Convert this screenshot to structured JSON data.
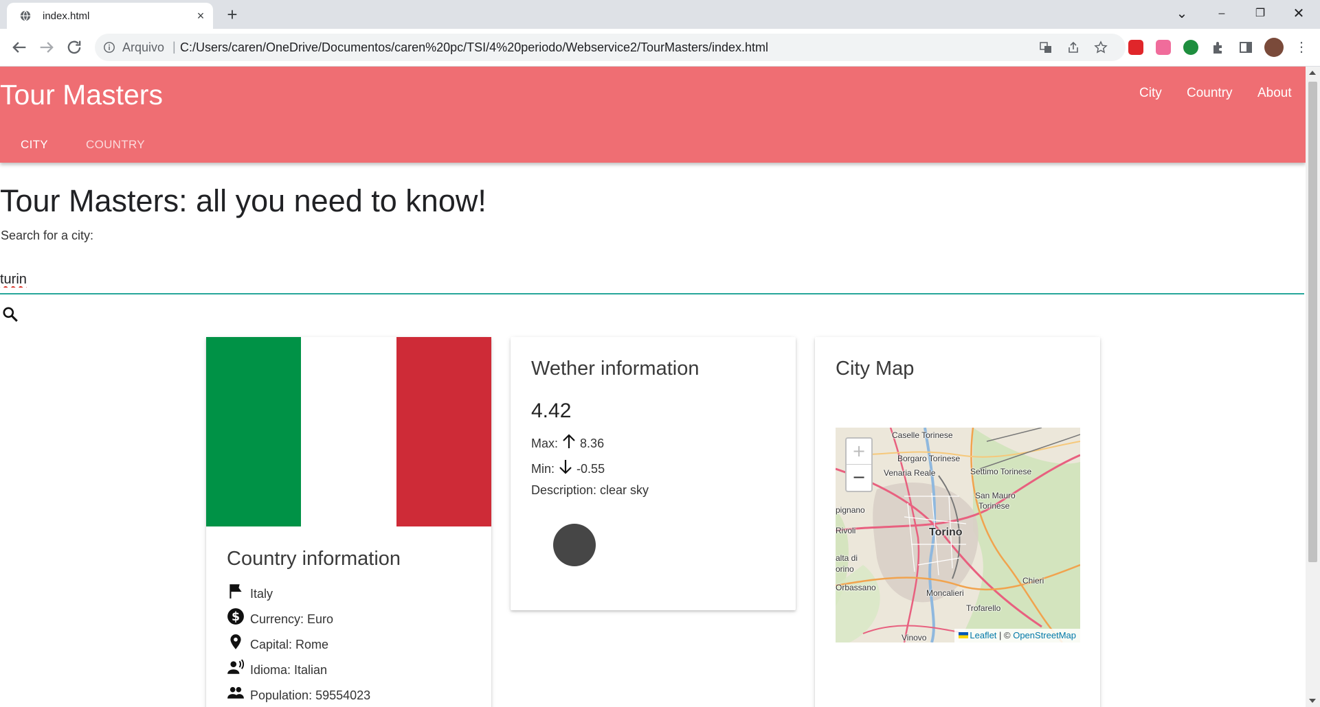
{
  "browser": {
    "tab_title": "index.html",
    "new_tab_glyph": "+",
    "close_glyph": "×",
    "address_prefix": "Arquivo",
    "address_separator": "|",
    "url": "C:/Users/caren/OneDrive/Documentos/caren%20pc/TSI/4%20periodo/Webservice2/TourMasters/index.html",
    "window_controls": {
      "minimize": "–",
      "maximize": "❐",
      "close": "✕",
      "tab_search": "⌄"
    }
  },
  "navbar": {
    "brand": "Tour Masters",
    "links": [
      "City",
      "Country",
      "About"
    ],
    "tabs": [
      "CITY",
      "COUNTRY"
    ],
    "background_color": "#ef6e73"
  },
  "hero": {
    "title": "Tour Masters: all you need to know!",
    "search_label": "Search for a city:",
    "search_value": "turin",
    "accent_color": "#26a69a"
  },
  "country_card": {
    "flag_colors": [
      "#009246",
      "#ffffff",
      "#ce2b37"
    ],
    "title": "Country information",
    "country": "Italy",
    "currency": "Currency: Euro",
    "capital": "Capital: Rome",
    "language": "Idioma: Italian",
    "population": "Population: 59554023"
  },
  "weather_card": {
    "title": "Wether information",
    "temperature": "4.42",
    "max_label": "Max:",
    "max_value": "8.36",
    "min_label": "Min:",
    "min_value": "-0.55",
    "description": "Description: clear sky"
  },
  "map_card": {
    "title": "City Map",
    "zoom_in": "+",
    "zoom_out": "−",
    "places": {
      "caselle": "Caselle Torinese",
      "borgaro": "Borgaro Torinese",
      "venaria": "Venaria Reale",
      "settimo": "Settimo Torinese",
      "san_mauro_1": "San Mauro",
      "san_mauro_2": "Torinese",
      "pignano": "pignano",
      "rivoli": "Rivoli",
      "torino": "Torino",
      "valta_1": "alta di",
      "valta_2": "orino",
      "orbassano": "Orbassano",
      "chieri": "Chieri",
      "moncalieri": "Moncalieri",
      "trofarello": "Trofarello",
      "vinovo": "Vinovo"
    },
    "attribution_leaflet": "Leaflet",
    "attribution_sep": " | © ",
    "attribution_osm": "OpenStreetMap"
  }
}
